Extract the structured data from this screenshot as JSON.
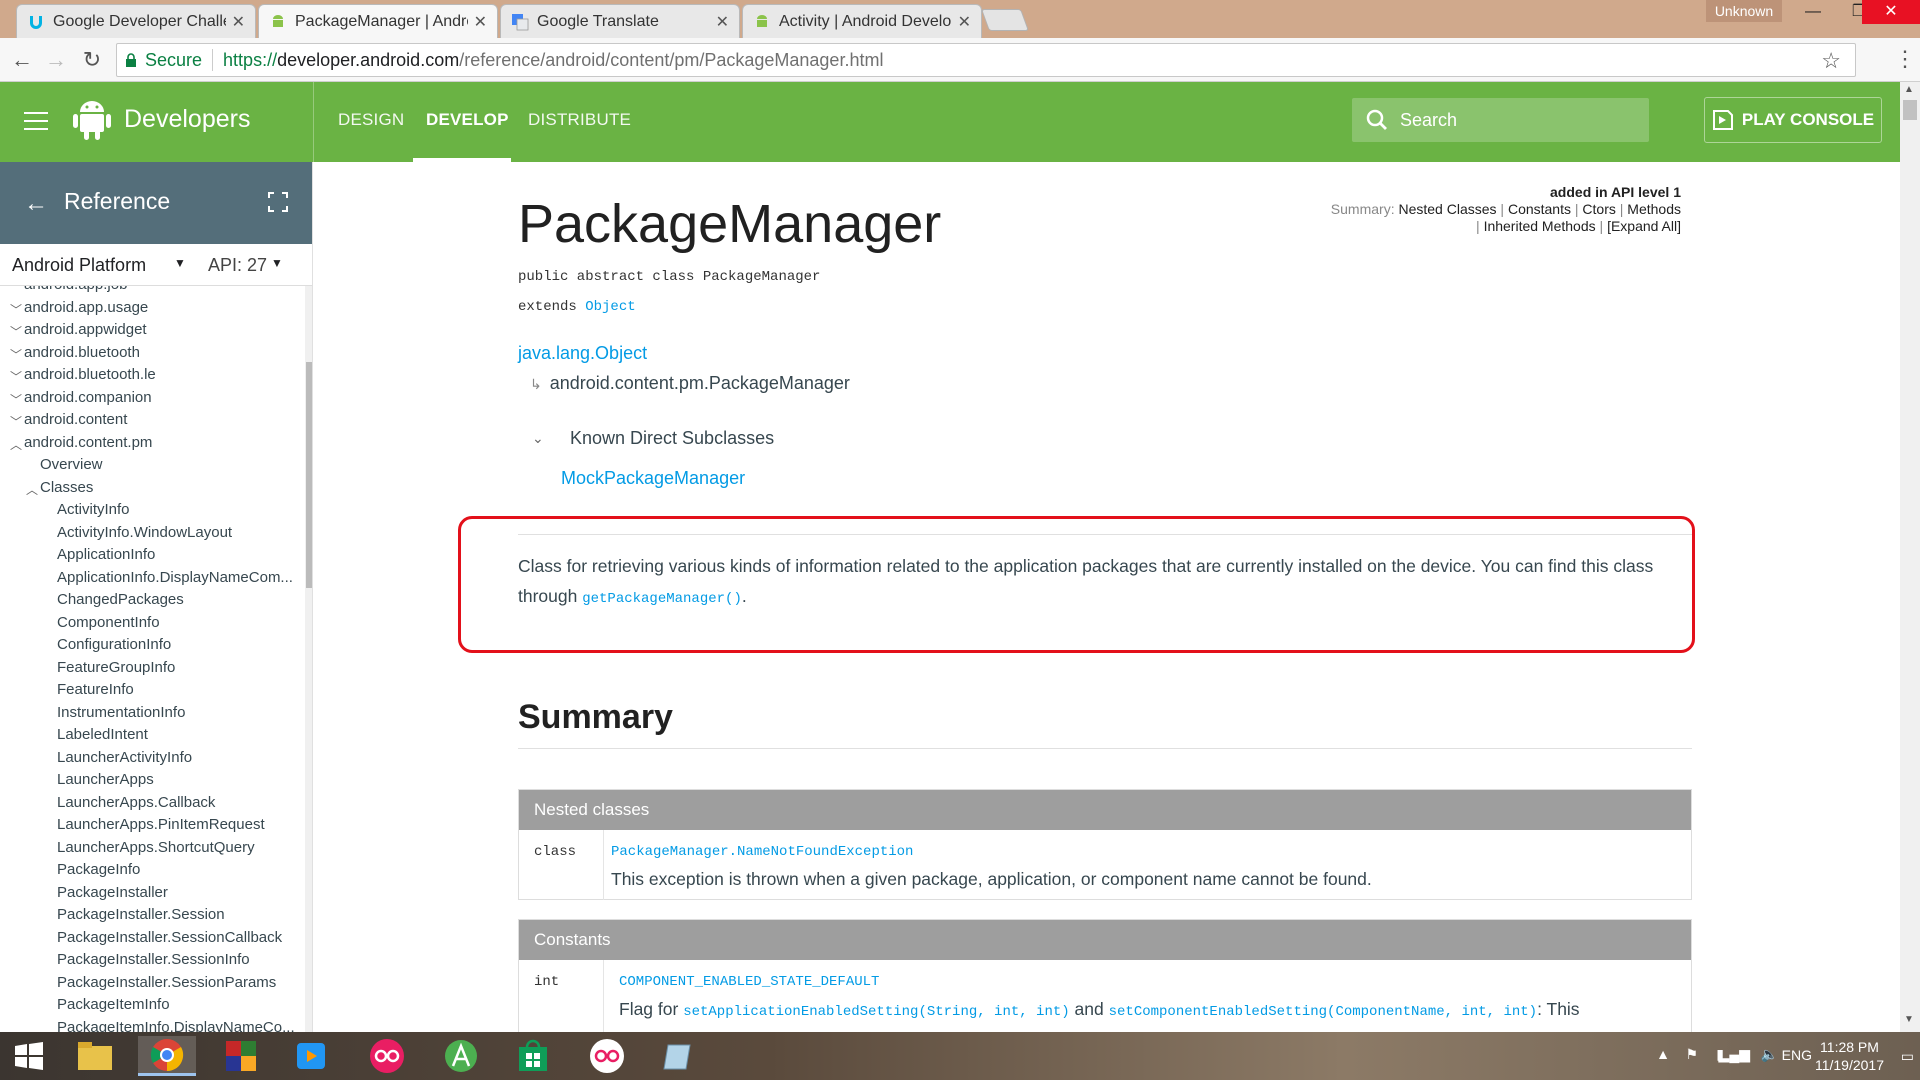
{
  "browser": {
    "tabs": [
      {
        "title": "Google Developer Challe",
        "active": false
      },
      {
        "title": "PackageManager | Andro",
        "active": true
      },
      {
        "title": "Google Translate",
        "active": false
      },
      {
        "title": "Activity | Android Develo",
        "active": false
      }
    ],
    "profile": "Unknown",
    "secure_label": "Secure",
    "url_scheme": "https://",
    "url_host": "developer.android.com",
    "url_path": "/reference/android/content/pm/PackageManager.html"
  },
  "header": {
    "brand": "Developers",
    "nav": [
      "DESIGN",
      "DEVELOP",
      "DISTRIBUTE"
    ],
    "search_placeholder": "Search",
    "play_console": "PLAY CONSOLE",
    "accent": "#6ab344"
  },
  "sidebar": {
    "title": "Reference",
    "platform": "Android Platform",
    "api": "API: 27",
    "items": [
      {
        "label": "android.app.job",
        "level": 0,
        "chevron": "down"
      },
      {
        "label": "android.app.usage",
        "level": 0,
        "chevron": "down"
      },
      {
        "label": "android.appwidget",
        "level": 0,
        "chevron": "down"
      },
      {
        "label": "android.bluetooth",
        "level": 0,
        "chevron": "down"
      },
      {
        "label": "android.bluetooth.le",
        "level": 0,
        "chevron": "down"
      },
      {
        "label": "android.companion",
        "level": 0,
        "chevron": "down"
      },
      {
        "label": "android.content",
        "level": 0,
        "chevron": "down"
      },
      {
        "label": "android.content.pm",
        "level": 0,
        "chevron": "up"
      },
      {
        "label": "Overview",
        "level": 1,
        "chevron": ""
      },
      {
        "label": "Classes",
        "level": 1,
        "chevron": "up"
      },
      {
        "label": "ActivityInfo",
        "level": 2,
        "chevron": ""
      },
      {
        "label": "ActivityInfo.WindowLayout",
        "level": 2,
        "chevron": ""
      },
      {
        "label": "ApplicationInfo",
        "level": 2,
        "chevron": ""
      },
      {
        "label": "ApplicationInfo.DisplayNameCom...",
        "level": 2,
        "chevron": ""
      },
      {
        "label": "ChangedPackages",
        "level": 2,
        "chevron": ""
      },
      {
        "label": "ComponentInfo",
        "level": 2,
        "chevron": ""
      },
      {
        "label": "ConfigurationInfo",
        "level": 2,
        "chevron": ""
      },
      {
        "label": "FeatureGroupInfo",
        "level": 2,
        "chevron": ""
      },
      {
        "label": "FeatureInfo",
        "level": 2,
        "chevron": ""
      },
      {
        "label": "InstrumentationInfo",
        "level": 2,
        "chevron": ""
      },
      {
        "label": "LabeledIntent",
        "level": 2,
        "chevron": ""
      },
      {
        "label": "LauncherActivityInfo",
        "level": 2,
        "chevron": ""
      },
      {
        "label": "LauncherApps",
        "level": 2,
        "chevron": ""
      },
      {
        "label": "LauncherApps.Callback",
        "level": 2,
        "chevron": ""
      },
      {
        "label": "LauncherApps.PinItemRequest",
        "level": 2,
        "chevron": ""
      },
      {
        "label": "LauncherApps.ShortcutQuery",
        "level": 2,
        "chevron": ""
      },
      {
        "label": "PackageInfo",
        "level": 2,
        "chevron": ""
      },
      {
        "label": "PackageInstaller",
        "level": 2,
        "chevron": ""
      },
      {
        "label": "PackageInstaller.Session",
        "level": 2,
        "chevron": ""
      },
      {
        "label": "PackageInstaller.SessionCallback",
        "level": 2,
        "chevron": ""
      },
      {
        "label": "PackageInstaller.SessionInfo",
        "level": 2,
        "chevron": ""
      },
      {
        "label": "PackageInstaller.SessionParams",
        "level": 2,
        "chevron": ""
      },
      {
        "label": "PackageItemInfo",
        "level": 2,
        "chevron": ""
      },
      {
        "label": "PackageItemInfo.DisplayNameCo...",
        "level": 2,
        "chevron": ""
      }
    ]
  },
  "main": {
    "api_level": "added in API level 1",
    "summary_label": "Summary:",
    "summary_links": [
      "Nested Classes",
      "Constants",
      "Ctors",
      "Methods"
    ],
    "summary_links_2": [
      "Inherited Methods",
      "[Expand All]"
    ],
    "class_title": "PackageManager",
    "declaration_1": "public abstract class PackageManager",
    "extends_kw": "extends",
    "extends_link": "Object",
    "inherit_root": "java.lang.Object",
    "inherit_child": "android.content.pm.PackageManager",
    "subclasses_label": "Known Direct Subclasses",
    "subclass": "MockPackageManager",
    "description_text": "Class for retrieving various kinds of information related to the application packages that are currently installed on the device. You can find this class through ",
    "description_code": "getPackageManager()",
    "description_end": ".",
    "summary_title": "Summary",
    "nested_header": "Nested classes",
    "nested_type": "class",
    "nested_name_prefix": "PackageManager.",
    "nested_name": "NameNotFoundException",
    "nested_desc": "This exception is thrown when a given package, application, or component name cannot be found.",
    "constants_header": "Constants",
    "const_type": "int",
    "const_name": "COMPONENT_ENABLED_STATE_DEFAULT",
    "const_desc_1": "Flag for ",
    "const_code_1": "setApplicationEnabledSetting(String, int, int)",
    "const_desc_2": " and ",
    "const_code_2": "setComponentEnabledSetting(ComponentName, int, int)",
    "const_desc_3": ": This",
    "highlight_color": "#e3101a"
  },
  "taskbar": {
    "lang": "ENG",
    "time": "11:28 PM",
    "date": "11/19/2017"
  }
}
